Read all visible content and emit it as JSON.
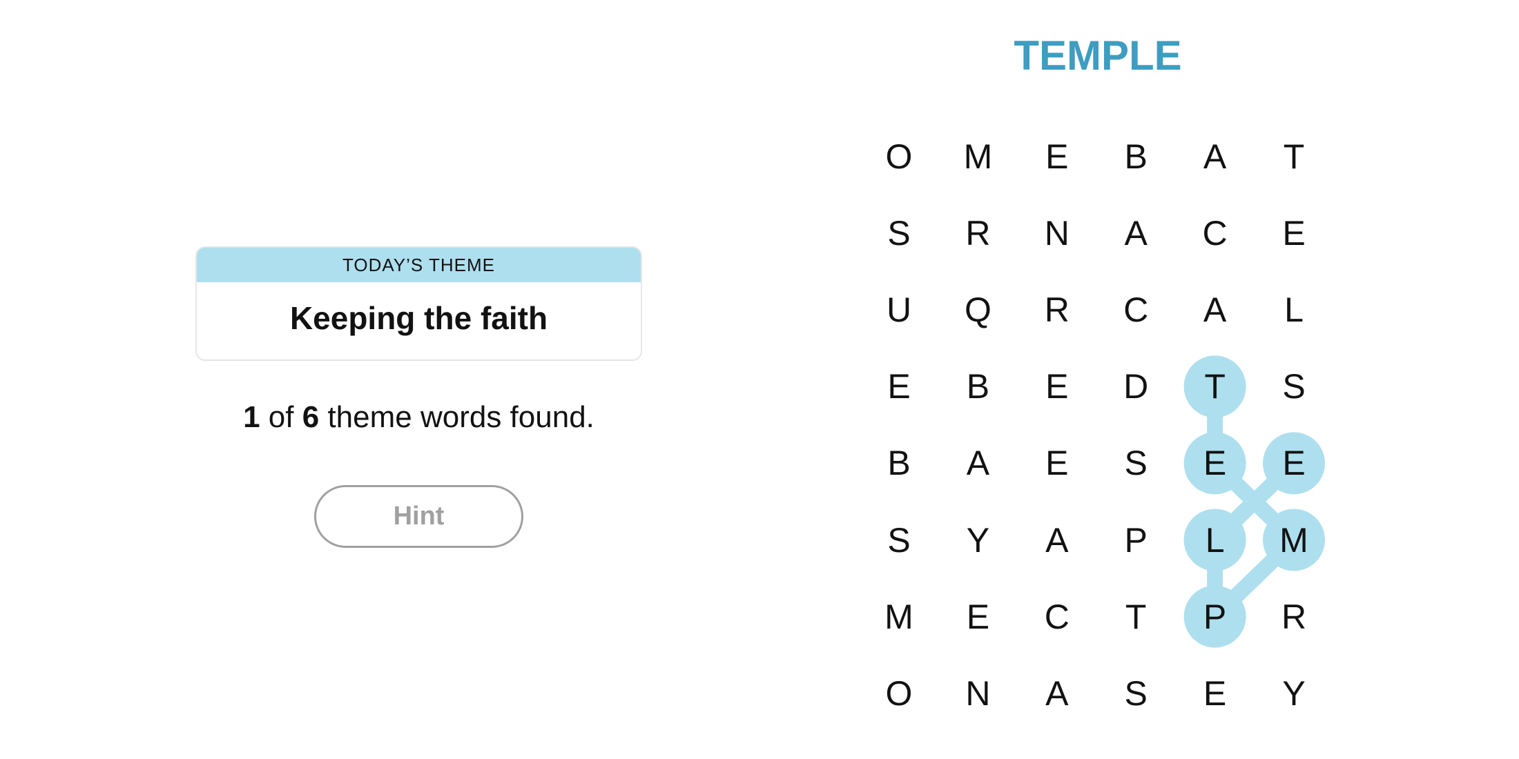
{
  "theme_card": {
    "header": "Today’s Theme",
    "theme": "Keeping the faith"
  },
  "status": {
    "found": "1",
    "of_text": " of ",
    "total": "6",
    "suffix": " theme words found."
  },
  "hint_button": {
    "label": "Hint"
  },
  "current_word": "TEMPLE",
  "colors": {
    "accent_text": "#3e9dc0",
    "highlight": "#aedfee",
    "theme_band": "#aedfee",
    "hint_disabled": "#a0a0a0"
  },
  "grid": {
    "rows": [
      [
        "O",
        "M",
        "E",
        "B",
        "A",
        "T"
      ],
      [
        "S",
        "R",
        "N",
        "A",
        "C",
        "E"
      ],
      [
        "U",
        "Q",
        "R",
        "C",
        "A",
        "L"
      ],
      [
        "E",
        "B",
        "E",
        "D",
        "T",
        "S"
      ],
      [
        "B",
        "A",
        "E",
        "S",
        "E",
        "E"
      ],
      [
        "S",
        "Y",
        "A",
        "P",
        "L",
        "M"
      ],
      [
        "M",
        "E",
        "C",
        "T",
        "P",
        "R"
      ],
      [
        "O",
        "N",
        "A",
        "S",
        "E",
        "Y"
      ]
    ],
    "selected_path": [
      {
        "row": 3,
        "col": 4,
        "letter": "T"
      },
      {
        "row": 4,
        "col": 4,
        "letter": "E"
      },
      {
        "row": 5,
        "col": 5,
        "letter": "M"
      },
      {
        "row": 6,
        "col": 4,
        "letter": "P"
      },
      {
        "row": 5,
        "col": 4,
        "letter": "L"
      },
      {
        "row": 4,
        "col": 5,
        "letter": "E"
      }
    ]
  }
}
